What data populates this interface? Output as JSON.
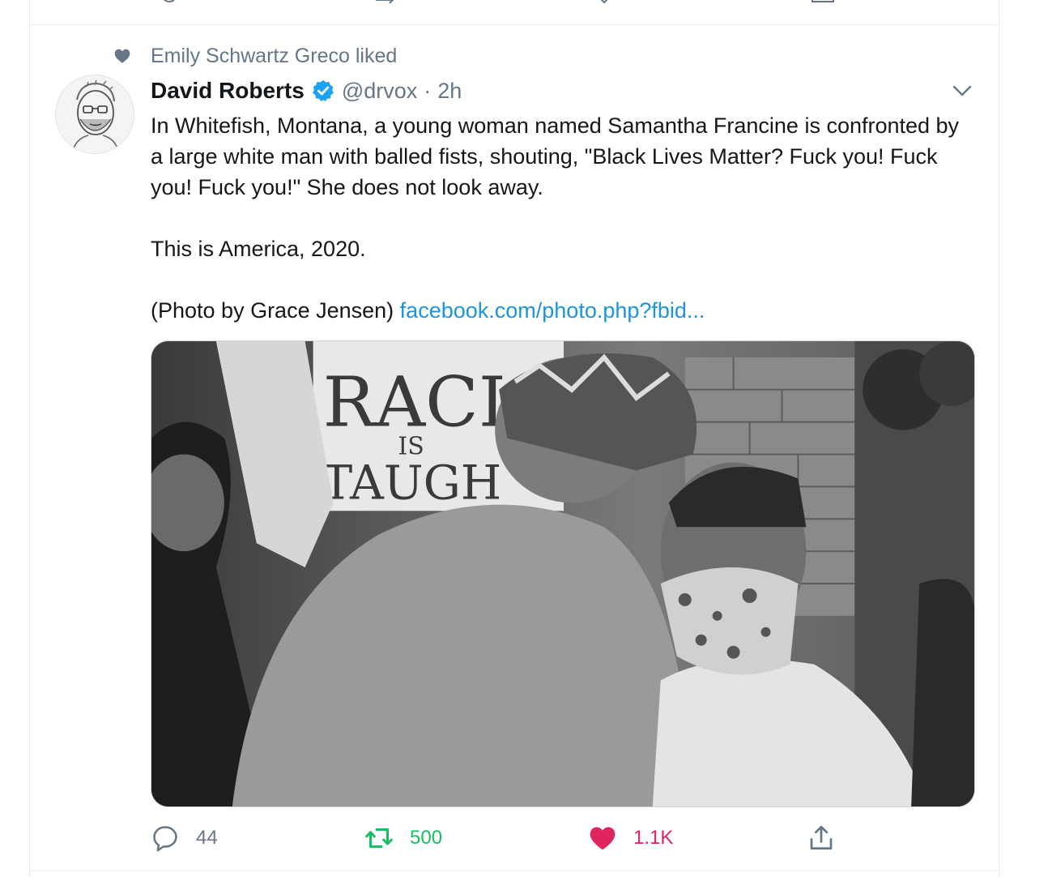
{
  "social_context": {
    "text": "Emily Schwartz Greco liked"
  },
  "tweet": {
    "author_name": "David Roberts",
    "author_handle": "@drvox",
    "separator": "·",
    "timestamp": "2h",
    "text_line1": "In Whitefish, Montana, a young woman named Samantha Francine is confronted by a large white man with balled fists, shouting, \"Black Lives Matter? Fuck you! Fuck you! Fuck you!\" She does not look away.",
    "text_line2": "This is America, 2020.",
    "text_line3_prefix": "(Photo by Grace Jensen)",
    "link_text": "facebook.com/photo.php?fbid...",
    "media_sign": {
      "line1": "RACIS",
      "line2": "IS",
      "line3": "TAUGH"
    }
  },
  "actions": {
    "reply_count": "44",
    "retweet_count": "500",
    "like_count": "1.1K"
  },
  "colors": {
    "secondary_text": "#657786",
    "link": "#1b95e0",
    "verified": "#1da1f2",
    "retweet_active": "#17bf63",
    "like_active": "#e0245e"
  },
  "icons": {
    "social_context": "heart-icon",
    "verified": "verified-badge-icon",
    "caret": "chevron-down-icon",
    "reply": "reply-icon",
    "retweet": "retweet-icon",
    "like": "heart-filled-icon",
    "share": "share-icon"
  }
}
